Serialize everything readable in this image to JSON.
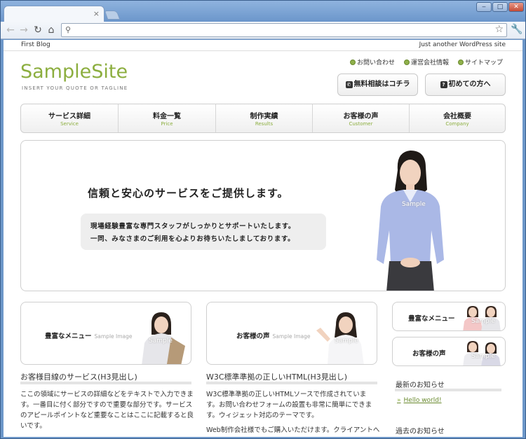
{
  "browser": {
    "tab_close": "×",
    "window_controls": [
      "‒",
      "□",
      "✕"
    ],
    "icons": [
      "back-icon",
      "forward-icon",
      "reload-icon",
      "home-icon",
      "search-icon",
      "star-icon",
      "wrench-icon"
    ]
  },
  "site": {
    "name": "First Blog",
    "description": "Just another WordPress site",
    "logo": "SampleSite",
    "logo_tagline": "INSERT YOUR QUOTE OR TAGLINE",
    "accent_color": "#8cae3f"
  },
  "utility_links": [
    {
      "label": "お問い合わせ"
    },
    {
      "label": "運営会社情報"
    },
    {
      "label": "サイトマップ"
    }
  ],
  "header_buttons": [
    {
      "label": "無料相談はコチラ",
      "icon": "phone-icon",
      "glyph": "✆"
    },
    {
      "label": "初めての方へ",
      "icon": "question-icon",
      "glyph": "?"
    }
  ],
  "global_nav": [
    {
      "ja": "サービス詳細",
      "en": "Service"
    },
    {
      "ja": "料金一覧",
      "en": "Price"
    },
    {
      "ja": "制作実績",
      "en": "Results"
    },
    {
      "ja": "お客様の声",
      "en": "Customer"
    },
    {
      "ja": "会社概要",
      "en": "Company"
    }
  ],
  "hero": {
    "title": "信頼と安心のサービスをご提供します。",
    "line1": "現場経験豊富な専門スタッフがしっかりとサポートいたします。",
    "line2": "一同、みなさまのご利用を心よりお待ちいたしましております。",
    "image_label": "Sample"
  },
  "cards": [
    {
      "title": "豊富なメニュー",
      "sub": "Sample Image",
      "image_label": "Sample"
    },
    {
      "title": "お客様の声",
      "sub": "Sample Image",
      "image_label": "Sample"
    }
  ],
  "side_cards": [
    {
      "title": "豊富なメニュー",
      "image_label": "Sample"
    },
    {
      "title": "お客様の声",
      "image_label": "Sample"
    }
  ],
  "content": [
    {
      "heading": "お客様目線のサービス(H3見出し)",
      "lines": [
        "ここの領域にサービスの詳細などをテキストで入力できま",
        "す。一番目に付く部分ですので重要な部分です。サービス",
        "のアピールポイントなど重要なことはここに記載すると良",
        "いです。"
      ]
    },
    {
      "heading": "W3C標準準拠の正しいHTML(H3見出し)",
      "lines": [
        "W3C標準準拠の正しいHTMLソースで作成されていま",
        "す。お問い合わせフォームの設置も非常に簡単にできま",
        "す。ウィジェット対応のテーマです。",
        "Web制作会社様でもご購入いただけます。クライアントへ"
      ]
    }
  ],
  "sidebar": {
    "news_heading": "最新のお知らせ",
    "news_chevron": "»",
    "news_link": "Hello world!",
    "past_heading": "過去のお知らせ"
  }
}
